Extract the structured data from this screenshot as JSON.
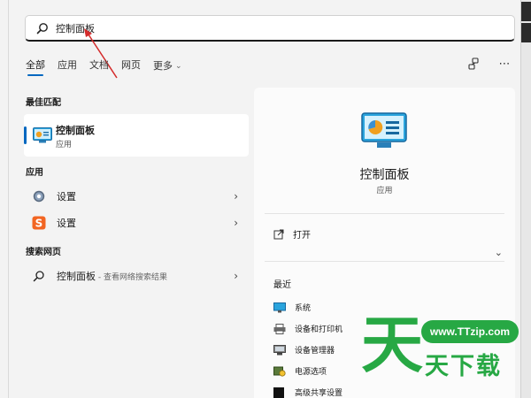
{
  "search": {
    "value": "控制面板"
  },
  "filters": [
    {
      "label": "全部",
      "active": true
    },
    {
      "label": "应用"
    },
    {
      "label": "文档"
    },
    {
      "label": "网页"
    },
    {
      "label": "更多"
    }
  ],
  "best_match": {
    "section_title": "最佳匹配",
    "name": "控制面板",
    "type": "应用"
  },
  "apps": {
    "section_title": "应用",
    "items": [
      {
        "label": "设置",
        "icon": "gear-icon"
      },
      {
        "label": "设置",
        "icon": "sogou-icon"
      }
    ]
  },
  "web": {
    "section_title": "搜索网页",
    "query": "控制面板",
    "hint": " - 查看网络搜索结果"
  },
  "detail": {
    "title": "控制面板",
    "subtitle": "应用",
    "open_label": "打开",
    "recent_title": "最近",
    "recent": [
      {
        "label": "系统"
      },
      {
        "label": "设备和打印机"
      },
      {
        "label": "设备管理器"
      },
      {
        "label": "电源选项"
      },
      {
        "label": "高级共享设置"
      }
    ]
  },
  "watermark": {
    "big_char": "天",
    "site": "www.TTzip.com",
    "words": "天下载"
  },
  "colors": {
    "accent": "#0067c0",
    "watermark_green": "#27a844",
    "annotation_red": "#d42a2a"
  }
}
